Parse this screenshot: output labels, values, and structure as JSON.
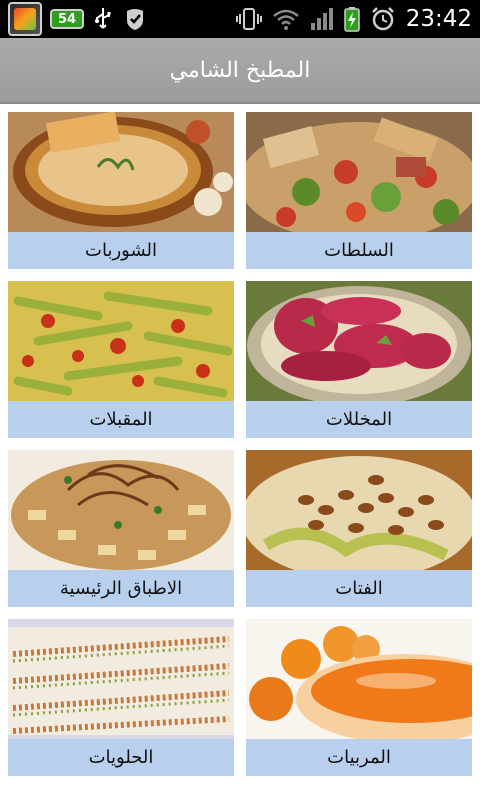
{
  "status_bar": {
    "battery_badge": "54",
    "time": "23:42",
    "icons": [
      "app-notification-icon",
      "battery-badge",
      "usb-icon",
      "shield-check-icon",
      "vibrate-icon",
      "wifi-icon",
      "signal-icon",
      "battery-charging-icon",
      "alarm-icon"
    ]
  },
  "header": {
    "title": "المطبخ الشامي"
  },
  "categories": [
    {
      "label": "السلطات",
      "image": "salad-photo",
      "colors": [
        "#c9a06a",
        "#5a8a2a",
        "#c83a2a"
      ]
    },
    {
      "label": "الشوربات",
      "image": "soup-photo",
      "colors": [
        "#c98a3a",
        "#e8c48a",
        "#7a4a1a"
      ]
    },
    {
      "label": "المخللات",
      "image": "pickles-photo",
      "colors": [
        "#b8294a",
        "#e8dcc0",
        "#6aa03a"
      ]
    },
    {
      "label": "المقبلات",
      "image": "appetizers-photo",
      "colors": [
        "#9ab03a",
        "#c8301a",
        "#d8c050"
      ]
    },
    {
      "label": "الفتات",
      "image": "fatteh-photo",
      "colors": [
        "#e8d8b0",
        "#8a4a1a",
        "#b8c050"
      ]
    },
    {
      "label": "الاطباق الرئيسية",
      "image": "main-dishes-photo",
      "colors": [
        "#c8985a",
        "#6a3a1a",
        "#eed8a0"
      ]
    },
    {
      "label": "المربيات",
      "image": "jams-photo",
      "colors": [
        "#f07a1a",
        "#f8d0a0",
        "#e89060"
      ]
    },
    {
      "label": "الحلويات",
      "image": "sweets-photo",
      "colors": [
        "#f2ece0",
        "#c8783a",
        "#8aa03a"
      ]
    }
  ]
}
